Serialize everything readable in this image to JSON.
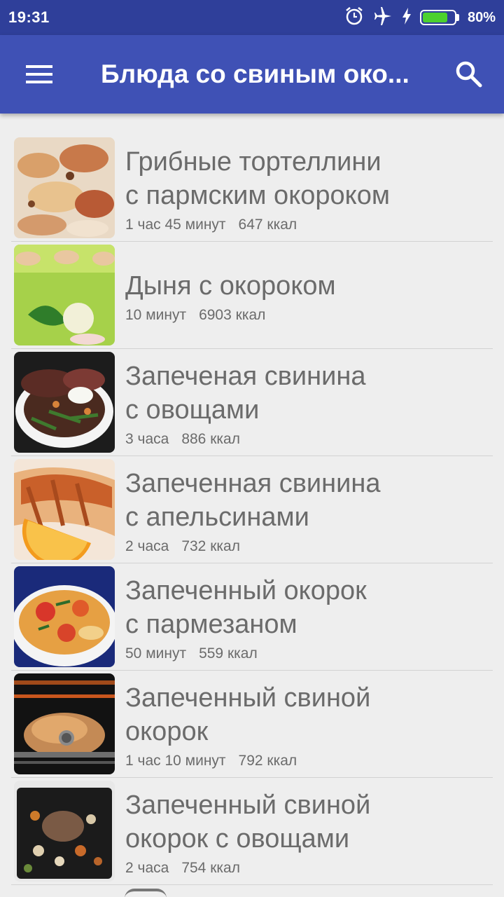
{
  "status_bar": {
    "time": "19:31",
    "battery": "80%",
    "battery_level": 0.8,
    "icons": [
      "alarm-icon",
      "airplane-icon",
      "charging-icon",
      "battery-icon"
    ]
  },
  "app_bar": {
    "title": "Блюда со свиным око...",
    "menu_icon": "menu-icon",
    "search_icon": "search-icon",
    "color": "#3f51b5"
  },
  "recipes": [
    {
      "name": "Грибные тортеллини\nс пармским окороком",
      "time": "1 час 45 минут",
      "kcal": "647 ккал"
    },
    {
      "name": "Дыня с окороком",
      "time": "10 минут",
      "kcal": "6903 ккал"
    },
    {
      "name": "Запеченая свинина\nс овощами",
      "time": "3 часа",
      "kcal": "886 ккал"
    },
    {
      "name": "Запеченная свинина\nс апельсинами",
      "time": "2 часа",
      "kcal": "732 ккал"
    },
    {
      "name": "Запеченный окорок\nс пармезаном",
      "time": "50 минут",
      "kcal": "559 ккал"
    },
    {
      "name": "Запеченный свиной\nокорок",
      "time": "1 час 10 минут",
      "kcal": "792 ккал"
    },
    {
      "name": "Запеченный свиной\nокорок с овощами",
      "time": "2 часа",
      "kcal": "754 ккал"
    }
  ]
}
